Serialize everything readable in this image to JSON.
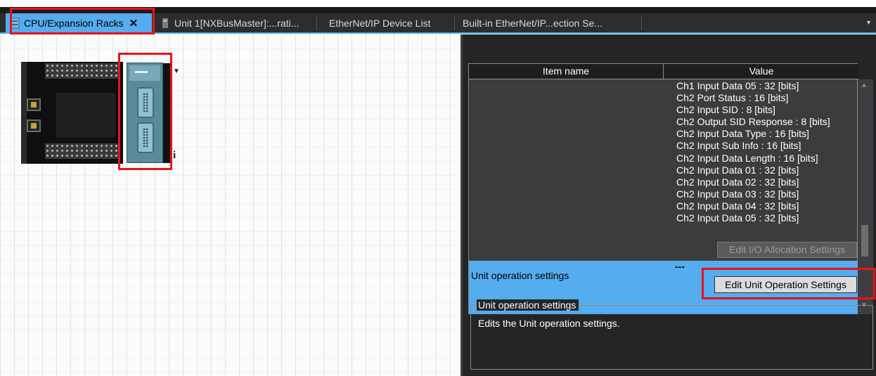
{
  "tabs": [
    {
      "label": "CPU/Expansion Racks",
      "active": true,
      "icon": "rack-icon"
    },
    {
      "label": "Unit 1[NXBusMaster]:...rati...",
      "active": false,
      "icon": "unit-icon"
    },
    {
      "label": "EtherNet/IP Device List",
      "active": false
    },
    {
      "label": "Built-in EtherNet/IP...ection Se...",
      "active": false
    }
  ],
  "grid": {
    "headers": {
      "item_name": "Item name",
      "value": "Value"
    },
    "values": [
      "Ch1 Input Data 05 : 32 [bits]",
      "Ch2 Port Status : 16 [bits]",
      "Ch2 Input SID : 8 [bits]",
      "Ch2 Output SID Response : 8 [bits]",
      "Ch2 Input Data Type : 16 [bits]",
      "Ch2 Input Sub Info : 16 [bits]",
      "Ch2 Input Data Length : 16 [bits]",
      "Ch2 Input Data 01 : 32 [bits]",
      "Ch2 Input Data 02 : 32 [bits]",
      "Ch2 Input Data 03 : 32 [bits]",
      "Ch2 Input Data 04 : 32 [bits]",
      "Ch2 Input Data 05 : 32 [bits]"
    ],
    "io_button": "Edit I/O Allocation Settings",
    "selected_row": {
      "label": "Unit operation settings",
      "value": "---",
      "button": "Edit Unit Operation Settings"
    }
  },
  "description": {
    "title": "Unit operation settings",
    "text": "Edits the Unit operation settings."
  },
  "colors": {
    "accent": "#55acee",
    "highlight": "#e8121b",
    "panel_bg": "#252526"
  }
}
